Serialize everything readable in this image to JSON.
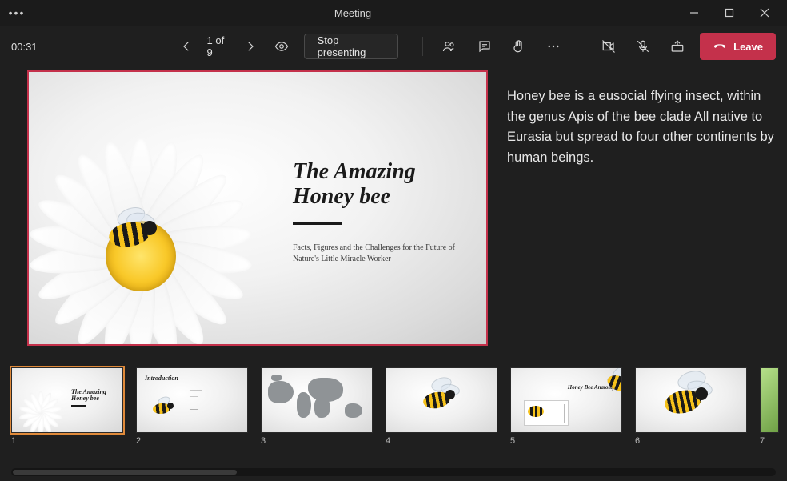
{
  "window": {
    "title": "Meeting"
  },
  "toolbar": {
    "timer": "00:31",
    "page_current": 1,
    "page_total": 9,
    "page_of_label": "1 of 9",
    "stop_presenting_label": "Stop presenting",
    "leave_label": "Leave"
  },
  "slide": {
    "title_line1": "The Amazing",
    "title_line2": "Honey bee",
    "subtitle": "Facts, Figures and the Challenges for the Future of Nature's Little Miracle Worker"
  },
  "notes": {
    "text": "Honey bee is a eusocial flying insect, within the genus Apis of the bee clade All native to Eurasia but spread to four other continents by human beings."
  },
  "thumbnails": [
    {
      "index": 1,
      "label": "The Amazing Honey bee",
      "active": true
    },
    {
      "index": 2,
      "label": "Introduction",
      "active": false
    },
    {
      "index": 3,
      "label": "",
      "active": false
    },
    {
      "index": 4,
      "label": "",
      "active": false
    },
    {
      "index": 5,
      "label": "Honey Bee Anatomy",
      "active": false
    },
    {
      "index": 6,
      "label": "",
      "active": false
    },
    {
      "index": 7,
      "label": "",
      "active": false
    }
  ],
  "colors": {
    "accent": "#c4314b",
    "selection": "#e08a3a",
    "bg": "#1f1f1f"
  }
}
